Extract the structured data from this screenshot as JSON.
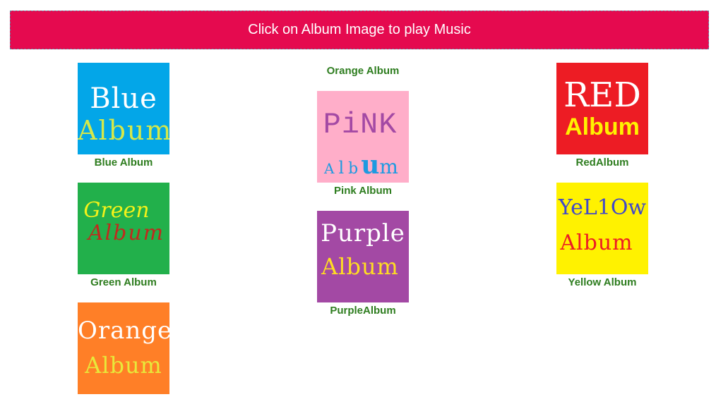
{
  "banner": {
    "text": "Click on Album Image to play Music"
  },
  "albums": {
    "blue": {
      "caption": "Blue Album",
      "cover_line1": "Blue",
      "cover_line2": "Album",
      "bg": "#03a6e8",
      "line1_color": "#ffffff",
      "line2_color": "#d4e84a"
    },
    "green": {
      "caption": "Green Album",
      "cover_line1": "Green",
      "cover_line2": "Album",
      "bg": "#22b04b",
      "line1_color": "#f3f21a",
      "line2_color": "#c02a1e"
    },
    "orange": {
      "caption": "Orange Album",
      "cover_line1": "Orange",
      "cover_line2": "Album",
      "bg": "#ff7f27",
      "line1_color": "#ffffff",
      "line2_color": "#e8e83a"
    },
    "pink": {
      "caption": "Pink Album",
      "cover_line1": "PiNK",
      "cover_line2_parts": [
        "A",
        "l",
        "b",
        "u",
        "m"
      ],
      "bg": "#ffaec9",
      "line1_color": "#a349a4",
      "line2_color": "#1e9ae0"
    },
    "purple": {
      "caption": "PurpleAlbum",
      "cover_line1": "Purple",
      "cover_line2": "Album",
      "bg": "#a349a4",
      "line1_color": "#ffffff",
      "line2_color": "#ffdd22"
    },
    "red": {
      "caption": "RedAlbum",
      "cover_line1": "RED",
      "cover_line2": "Album",
      "bg": "#ed1c24",
      "line1_color": "#ffffff",
      "line2_color": "#fff200"
    },
    "yellow": {
      "caption": "Yellow Album",
      "cover_line1": "YeL1Ow",
      "cover_line2": "Album",
      "bg": "#fff200",
      "line1_color": "#3f48cc",
      "line2_color": "#ed1c24"
    }
  }
}
